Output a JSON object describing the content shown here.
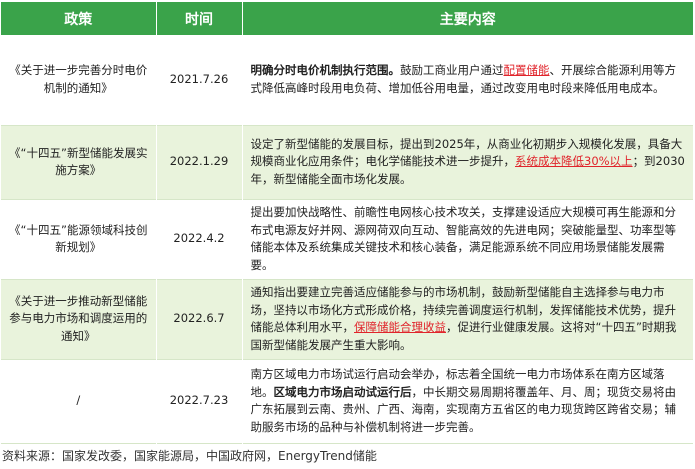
{
  "header": {
    "col_policy": "政策",
    "col_date": "时间",
    "col_content": "主要内容"
  },
  "rows": [
    {
      "policy": "《关于进一步完善分时电价机制的通知》",
      "date": "2021.7.26",
      "content": [
        {
          "t": "明确分时电价机制执行范围。",
          "s": "bold"
        },
        {
          "t": "鼓励工商业用户通过",
          "s": ""
        },
        {
          "t": "配置储能",
          "s": "hl"
        },
        {
          "t": "、开展综合能源利用等方式降低高峰时段用电负荷、增加低谷用电量，通过改变用电时段来降低用电成本。",
          "s": ""
        }
      ]
    },
    {
      "policy": "《“十四五”新型储能发展实施方案》",
      "date": "2022.1.29",
      "content": [
        {
          "t": "设定了新型储能的发展目标，提出到2025年，从商业化初期步入规模化发展，具备大规模商业化应用条件；电化学储能技术进一步提升，",
          "s": ""
        },
        {
          "t": "系统成本降低30%以上",
          "s": "hl"
        },
        {
          "t": "；到2030年，新型储能全面市场化发展。",
          "s": ""
        }
      ]
    },
    {
      "policy": "《“十四五”能源领域科技创新规划》",
      "date": "2022.4.2",
      "content": [
        {
          "t": "提出要加快战略性、前瞻性电网核心技术攻关，支撑建设适应大规模可再生能源和分布式电源友好并网、源网荷双向互动、智能高效的先进电网；突破能量型、功率型等储能本体及系统集成关键技术和核心装备，满足能源系统不同应用场景储能发展需要。",
          "s": ""
        }
      ]
    },
    {
      "policy": "《关于进一步推动新型储能参与电力市场和调度运用的通知》",
      "date": "2022.6.7",
      "content": [
        {
          "t": "通知指出要建立完善适应储能参与的市场机制，鼓励新型储能自主选择参与电力市场，坚持以市场化方式形成价格，持续完善调度运行机制，发挥储能技术优势，提升储能总体利用水平，",
          "s": ""
        },
        {
          "t": "保障储能合理收益",
          "s": "hl"
        },
        {
          "t": "，促进行业健康发展。这将对“十四五”时期我国新型储能发展产生重大影响。",
          "s": ""
        }
      ]
    },
    {
      "policy": "/",
      "date": "2022.7.23",
      "content": [
        {
          "t": "南方区域电力市场试运行启动会举办，标志着全国统一电力市场体系在南方区域落地。",
          "s": ""
        },
        {
          "t": "区域电力市场启动试运行后",
          "s": "bold"
        },
        {
          "t": "，中长期交易周期将覆盖年、月、周；现货交易将由广东拓展到云南、贵州、广西、海南，实现南方五省区的电力现货跨区跨省交易；辅助服务市场的品种与补偿机制将进一步完善。",
          "s": ""
        }
      ]
    }
  ],
  "source": "资料来源：国家发改委，国家能源局，中国政府网，EnergyTrend储能",
  "watermark": {
    "text": "EnergyTrend"
  },
  "colors": {
    "header_bg": "#3aa34a",
    "stripe_bg": "#e9f3dc",
    "highlight": "#e0242b"
  }
}
